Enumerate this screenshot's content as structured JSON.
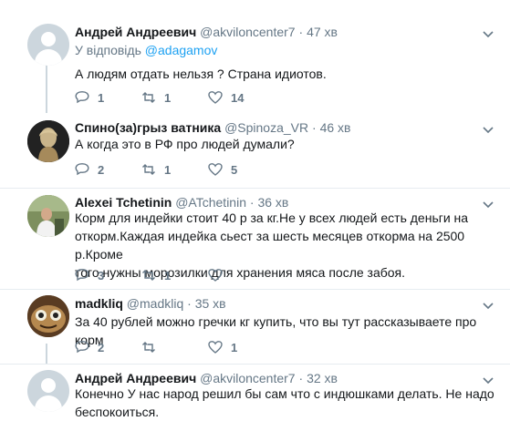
{
  "tweets": [
    {
      "name": "Андрей Андреевич",
      "handle": "@akviloncenter7",
      "time": "47 хв",
      "reply_prefix": "У відповідь ",
      "reply_mention": "@adagamov",
      "text": "А людям отдать нельзя ? Страна идиотов.",
      "replies": "1",
      "retweets": "1",
      "likes": "14"
    },
    {
      "name": "Спино(за)грыз ватника",
      "handle": "@Spinoza_VR",
      "time": "46 хв",
      "text": "А когда это в РФ про людей думали?",
      "replies": "2",
      "retweets": "1",
      "likes": "5"
    },
    {
      "name": "Alexei Tchetinin",
      "handle": "@ATchetinin",
      "time": "36 хв",
      "text_lines": [
        "Корм для индейки стоит 40 р за кг.Не у всех людей есть деньги на",
        "откорм.Каждая индейка сьест за шесть месяцев откорма на 2500 р.Кроме",
        "того нужны морозилки для хранения мяса после забоя."
      ],
      "replies": "3",
      "retweets": "1",
      "likes": ""
    },
    {
      "name": "madkliq",
      "handle": "@madkliq",
      "time": "35 хв",
      "text": "За 40 рублей можно гречки кг купить, что вы тут рассказываете про корм",
      "replies": "2",
      "retweets": "",
      "likes": "1"
    },
    {
      "name": "Андрей Андреевич",
      "handle": "@akviloncenter7",
      "time": "32 хв",
      "text_lines": [
        "Конечно У нас народ решил бы сам что с индюшками делать. Не надо",
        "беспокоиться."
      ]
    }
  ],
  "separator": "·"
}
